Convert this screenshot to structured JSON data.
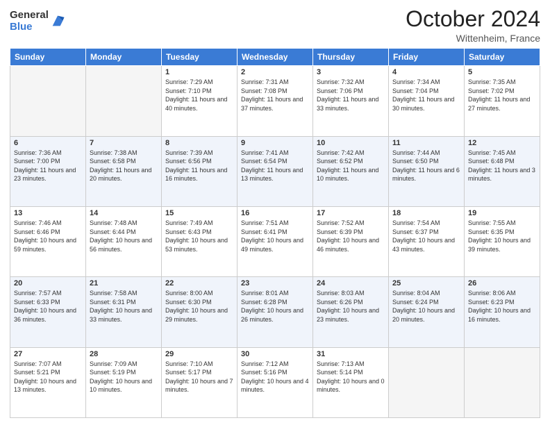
{
  "header": {
    "logo_general": "General",
    "logo_blue": "Blue",
    "main_title": "October 2024",
    "subtitle": "Wittenheim, France"
  },
  "weekdays": [
    "Sunday",
    "Monday",
    "Tuesday",
    "Wednesday",
    "Thursday",
    "Friday",
    "Saturday"
  ],
  "weeks": [
    [
      {
        "day": "",
        "info": ""
      },
      {
        "day": "",
        "info": ""
      },
      {
        "day": "1",
        "info": "Sunrise: 7:29 AM\nSunset: 7:10 PM\nDaylight: 11 hours and 40 minutes."
      },
      {
        "day": "2",
        "info": "Sunrise: 7:31 AM\nSunset: 7:08 PM\nDaylight: 11 hours and 37 minutes."
      },
      {
        "day": "3",
        "info": "Sunrise: 7:32 AM\nSunset: 7:06 PM\nDaylight: 11 hours and 33 minutes."
      },
      {
        "day": "4",
        "info": "Sunrise: 7:34 AM\nSunset: 7:04 PM\nDaylight: 11 hours and 30 minutes."
      },
      {
        "day": "5",
        "info": "Sunrise: 7:35 AM\nSunset: 7:02 PM\nDaylight: 11 hours and 27 minutes."
      }
    ],
    [
      {
        "day": "6",
        "info": "Sunrise: 7:36 AM\nSunset: 7:00 PM\nDaylight: 11 hours and 23 minutes."
      },
      {
        "day": "7",
        "info": "Sunrise: 7:38 AM\nSunset: 6:58 PM\nDaylight: 11 hours and 20 minutes."
      },
      {
        "day": "8",
        "info": "Sunrise: 7:39 AM\nSunset: 6:56 PM\nDaylight: 11 hours and 16 minutes."
      },
      {
        "day": "9",
        "info": "Sunrise: 7:41 AM\nSunset: 6:54 PM\nDaylight: 11 hours and 13 minutes."
      },
      {
        "day": "10",
        "info": "Sunrise: 7:42 AM\nSunset: 6:52 PM\nDaylight: 11 hours and 10 minutes."
      },
      {
        "day": "11",
        "info": "Sunrise: 7:44 AM\nSunset: 6:50 PM\nDaylight: 11 hours and 6 minutes."
      },
      {
        "day": "12",
        "info": "Sunrise: 7:45 AM\nSunset: 6:48 PM\nDaylight: 11 hours and 3 minutes."
      }
    ],
    [
      {
        "day": "13",
        "info": "Sunrise: 7:46 AM\nSunset: 6:46 PM\nDaylight: 10 hours and 59 minutes."
      },
      {
        "day": "14",
        "info": "Sunrise: 7:48 AM\nSunset: 6:44 PM\nDaylight: 10 hours and 56 minutes."
      },
      {
        "day": "15",
        "info": "Sunrise: 7:49 AM\nSunset: 6:43 PM\nDaylight: 10 hours and 53 minutes."
      },
      {
        "day": "16",
        "info": "Sunrise: 7:51 AM\nSunset: 6:41 PM\nDaylight: 10 hours and 49 minutes."
      },
      {
        "day": "17",
        "info": "Sunrise: 7:52 AM\nSunset: 6:39 PM\nDaylight: 10 hours and 46 minutes."
      },
      {
        "day": "18",
        "info": "Sunrise: 7:54 AM\nSunset: 6:37 PM\nDaylight: 10 hours and 43 minutes."
      },
      {
        "day": "19",
        "info": "Sunrise: 7:55 AM\nSunset: 6:35 PM\nDaylight: 10 hours and 39 minutes."
      }
    ],
    [
      {
        "day": "20",
        "info": "Sunrise: 7:57 AM\nSunset: 6:33 PM\nDaylight: 10 hours and 36 minutes."
      },
      {
        "day": "21",
        "info": "Sunrise: 7:58 AM\nSunset: 6:31 PM\nDaylight: 10 hours and 33 minutes."
      },
      {
        "day": "22",
        "info": "Sunrise: 8:00 AM\nSunset: 6:30 PM\nDaylight: 10 hours and 29 minutes."
      },
      {
        "day": "23",
        "info": "Sunrise: 8:01 AM\nSunset: 6:28 PM\nDaylight: 10 hours and 26 minutes."
      },
      {
        "day": "24",
        "info": "Sunrise: 8:03 AM\nSunset: 6:26 PM\nDaylight: 10 hours and 23 minutes."
      },
      {
        "day": "25",
        "info": "Sunrise: 8:04 AM\nSunset: 6:24 PM\nDaylight: 10 hours and 20 minutes."
      },
      {
        "day": "26",
        "info": "Sunrise: 8:06 AM\nSunset: 6:23 PM\nDaylight: 10 hours and 16 minutes."
      }
    ],
    [
      {
        "day": "27",
        "info": "Sunrise: 7:07 AM\nSunset: 5:21 PM\nDaylight: 10 hours and 13 minutes."
      },
      {
        "day": "28",
        "info": "Sunrise: 7:09 AM\nSunset: 5:19 PM\nDaylight: 10 hours and 10 minutes."
      },
      {
        "day": "29",
        "info": "Sunrise: 7:10 AM\nSunset: 5:17 PM\nDaylight: 10 hours and 7 minutes."
      },
      {
        "day": "30",
        "info": "Sunrise: 7:12 AM\nSunset: 5:16 PM\nDaylight: 10 hours and 4 minutes."
      },
      {
        "day": "31",
        "info": "Sunrise: 7:13 AM\nSunset: 5:14 PM\nDaylight: 10 hours and 0 minutes."
      },
      {
        "day": "",
        "info": ""
      },
      {
        "day": "",
        "info": ""
      }
    ]
  ]
}
